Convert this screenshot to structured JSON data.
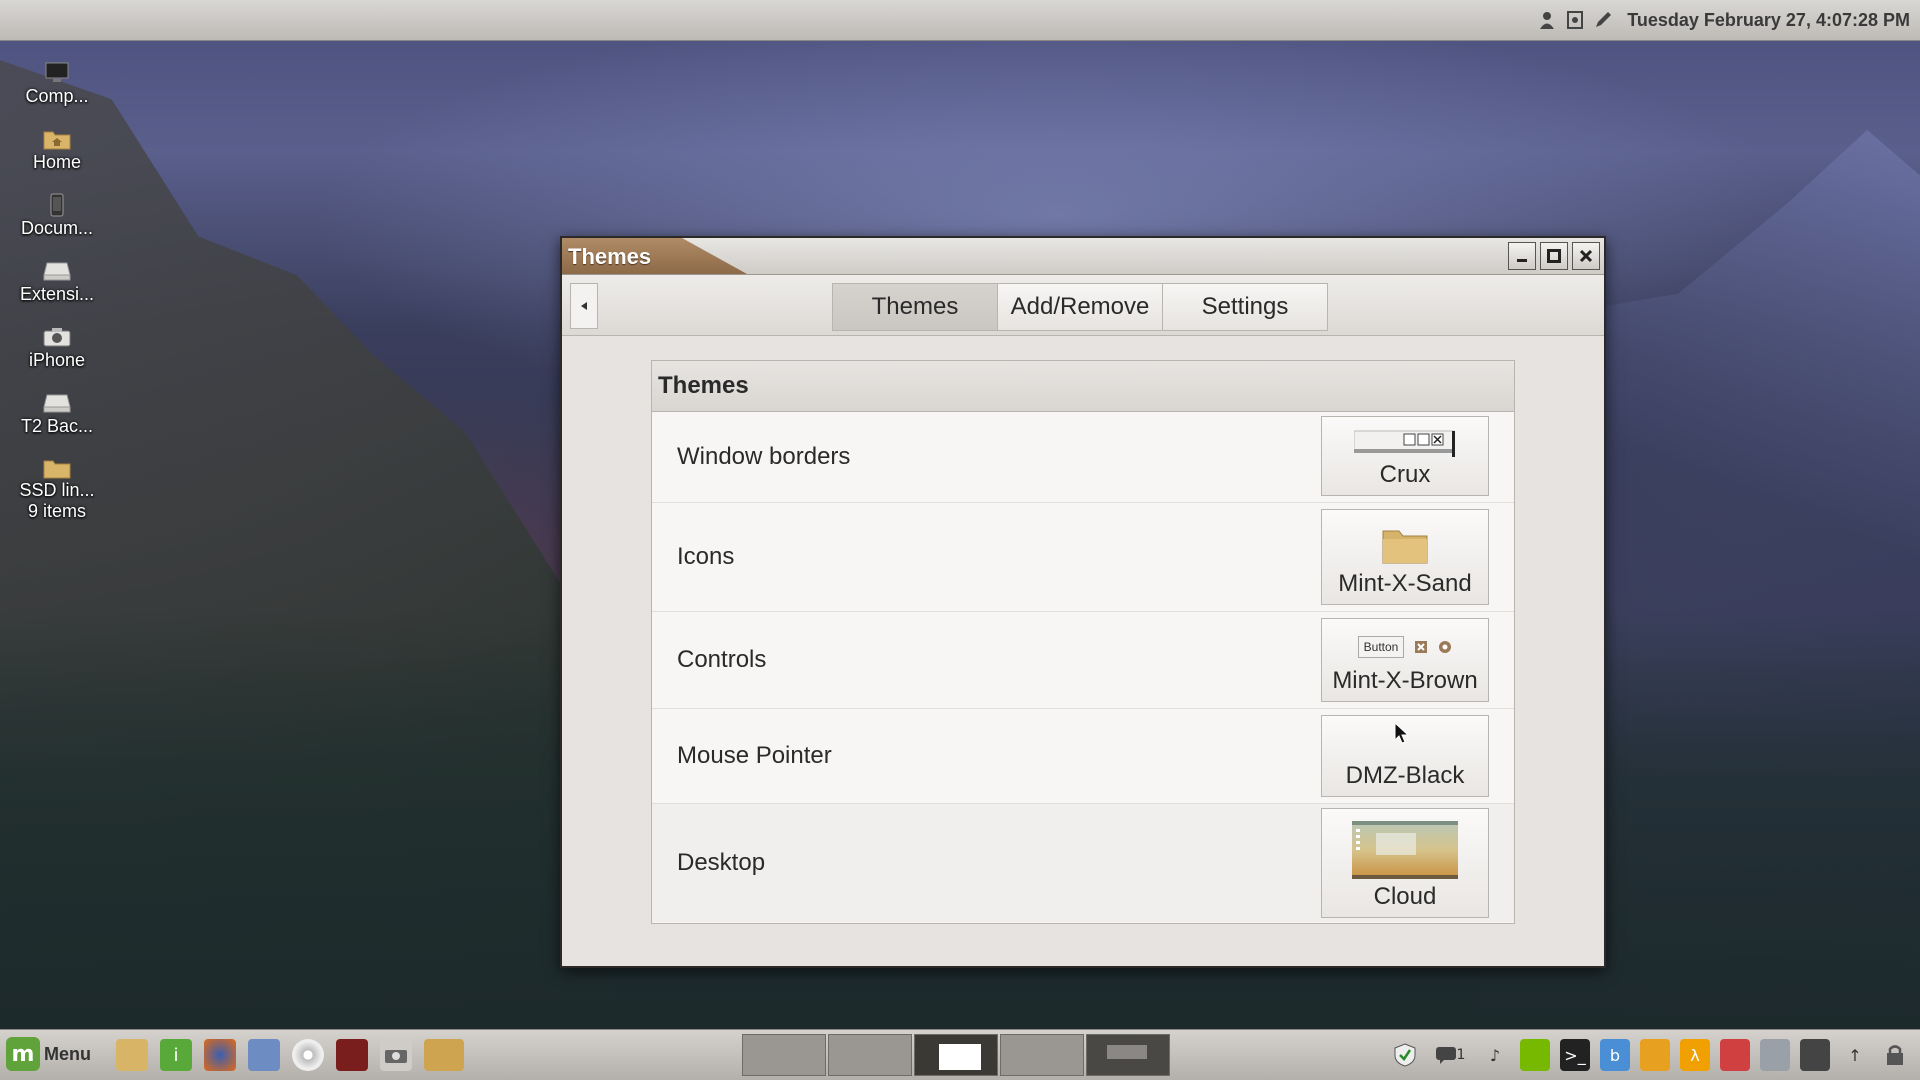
{
  "top_panel": {
    "clock": "Tuesday February 27,  4:07:28 PM",
    "icons": [
      "user-icon",
      "screenshot-icon",
      "pen-icon"
    ]
  },
  "desktop_icons": [
    {
      "label": "Comp...",
      "icon": "computer-icon"
    },
    {
      "label": "Home",
      "icon": "home-folder-icon"
    },
    {
      "label": "Docum...",
      "icon": "phone-device-icon"
    },
    {
      "label": "Extensi...",
      "icon": "drive-icon"
    },
    {
      "label": "iPhone",
      "icon": "camera-icon"
    },
    {
      "label": "T2 Bac...",
      "icon": "drive-icon"
    },
    {
      "label": "SSD lin...",
      "sub": "9 items",
      "icon": "folder-icon"
    }
  ],
  "window": {
    "title": "Themes",
    "tabs": [
      {
        "label": "Themes",
        "active": true
      },
      {
        "label": "Add/Remove",
        "active": false
      },
      {
        "label": "Settings",
        "active": false
      }
    ],
    "panel_title": "Themes",
    "rows": [
      {
        "label": "Window borders",
        "value": "Crux"
      },
      {
        "label": "Icons",
        "value": "Mint-X-Sand"
      },
      {
        "label": "Controls",
        "value": "Mint-X-Brown",
        "preview_button": "Button"
      },
      {
        "label": "Mouse Pointer",
        "value": "DMZ-Black"
      },
      {
        "label": "Desktop",
        "value": "Cloud"
      }
    ]
  },
  "taskbar": {
    "menu_label": "Menu",
    "launchers": [
      "files-icon",
      "info-icon",
      "firefox-icon",
      "finder-icon",
      "disc-icon",
      "pdf-icon",
      "camera-icon",
      "folder-icon"
    ],
    "tray": [
      "shield-icon",
      "chat-icon",
      "music-icon",
      "nvidia-icon",
      "terminal-icon",
      "b-icon",
      "badge-icon",
      "a-icon",
      "globe-icon",
      "window-icon",
      "tools-icon",
      "upload-icon",
      "lock-icon"
    ],
    "chat_count": "1"
  },
  "colors": {
    "accent_title": "#9b7550",
    "mint_green": "#5fa33a"
  }
}
